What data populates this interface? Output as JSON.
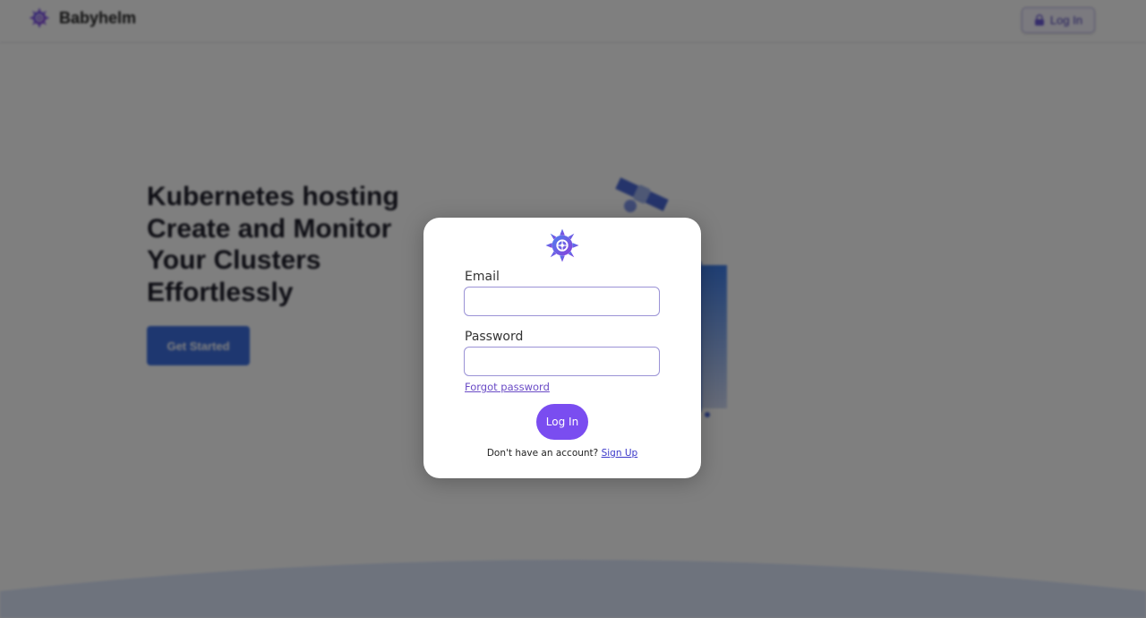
{
  "app": {
    "brand_name": "Babyhelm",
    "logo_icon": "helm-wheel-icon"
  },
  "topbar": {
    "login_label": "Log In",
    "login_icon": "lock-icon"
  },
  "hero": {
    "title_lines": [
      "Kubernetes hosting",
      "Create and Monitor",
      "Your Clusters",
      "Effortlessly"
    ],
    "cta_label": "Get Started",
    "illustration": "satellite-server-illustration"
  },
  "login_modal": {
    "logo_icon": "helm-wheel-icon",
    "email_label": "Email",
    "email_value": "",
    "password_label": "Password",
    "password_value": "",
    "forgot_password_label": "Forgot password",
    "submit_label": "Log In",
    "signup_prompt": "Don't have an account?",
    "signup_link_label": "Sign Up"
  },
  "colors": {
    "accent": "#7a4df0",
    "brand_blue": "#3d6fe0",
    "overlay": "rgba(0,0,0,0.5)",
    "link": "#3a37c9"
  }
}
